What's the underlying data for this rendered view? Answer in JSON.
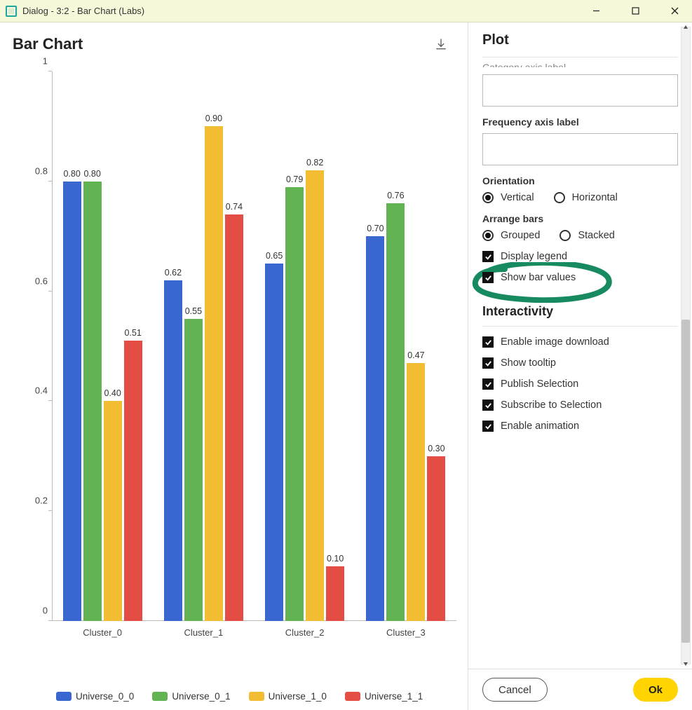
{
  "window": {
    "title": "Dialog - 3:2 - Bar Chart (Labs)"
  },
  "chart": {
    "title": "Bar Chart"
  },
  "chart_data": {
    "type": "bar",
    "title": "Bar Chart",
    "xlabel": "",
    "ylabel": "",
    "ylim": [
      0,
      1
    ],
    "yticks": [
      0,
      0.2,
      0.4,
      0.6,
      0.8,
      1
    ],
    "categories": [
      "Cluster_0",
      "Cluster_1",
      "Cluster_2",
      "Cluster_3"
    ],
    "series": [
      {
        "name": "Universe_0_0",
        "color": "#3a66cf",
        "values": [
          0.8,
          0.62,
          0.65,
          0.7
        ]
      },
      {
        "name": "Universe_0_1",
        "color": "#62b452",
        "values": [
          0.8,
          0.55,
          0.79,
          0.76
        ]
      },
      {
        "name": "Universe_1_0",
        "color": "#f3bd33",
        "values": [
          0.4,
          0.9,
          0.82,
          0.47
        ]
      },
      {
        "name": "Universe_1_1",
        "color": "#e34d44",
        "values": [
          0.51,
          0.74,
          0.1,
          0.3
        ]
      }
    ],
    "legend_position": "bottom",
    "grid": false,
    "show_values": true
  },
  "panel": {
    "title": "Plot",
    "hidden_top_label": "Category axis label",
    "fields": {
      "category_axis_label": "",
      "category_axis_placeholder": "",
      "frequency_axis_label_caption": "Frequency axis label",
      "frequency_axis_label": ""
    },
    "orientation": {
      "label": "Orientation",
      "options": [
        "Vertical",
        "Horizontal"
      ],
      "selected": "Vertical"
    },
    "arrange": {
      "label": "Arrange bars",
      "options": [
        "Grouped",
        "Stacked"
      ],
      "selected": "Grouped"
    },
    "display_checks": {
      "display_legend": {
        "label": "Display legend",
        "checked": true
      },
      "show_bar_values": {
        "label": "Show bar values",
        "checked": true
      }
    },
    "interactivity": {
      "heading": "Interactivity",
      "items": [
        {
          "label": "Enable image download",
          "checked": true
        },
        {
          "label": "Show tooltip",
          "checked": true
        },
        {
          "label": "Publish Selection",
          "checked": true
        },
        {
          "label": "Subscribe to Selection",
          "checked": true
        },
        {
          "label": "Enable animation",
          "checked": true
        }
      ]
    },
    "buttons": {
      "cancel": "Cancel",
      "ok": "Ok"
    }
  }
}
